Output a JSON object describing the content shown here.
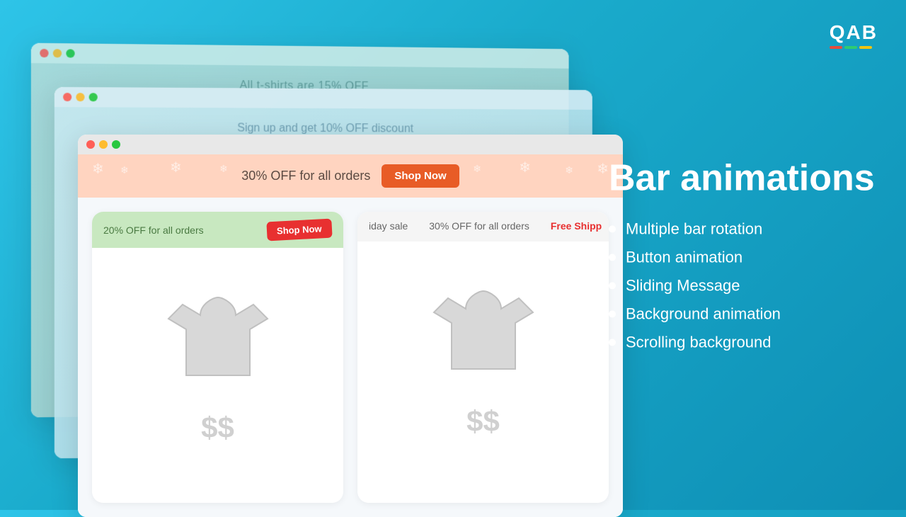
{
  "logo": {
    "text": "QAB",
    "bars": [
      "red",
      "green",
      "yellow"
    ]
  },
  "window3": {
    "announcement": "All t-shirts are 15% OFF"
  },
  "window2": {
    "announcement": "Sign up and get 10% OFF discount"
  },
  "window1": {
    "announcement_bar": {
      "text": "30% OFF for all orders",
      "button_label": "Shop Now"
    },
    "left_card": {
      "announcement_text": "20% OFF for all orders",
      "button_label": "Shop Now",
      "price": "$$"
    },
    "right_card": {
      "ticker_items": [
        "iday sale",
        "30% OFF for all orders",
        "Free Shipp"
      ],
      "price": "$$"
    }
  },
  "right_panel": {
    "title": "Bar animations",
    "features": [
      "Multiple bar rotation",
      "Button animation",
      "Sliding Message",
      "Background animation",
      "Scrolling background"
    ]
  }
}
